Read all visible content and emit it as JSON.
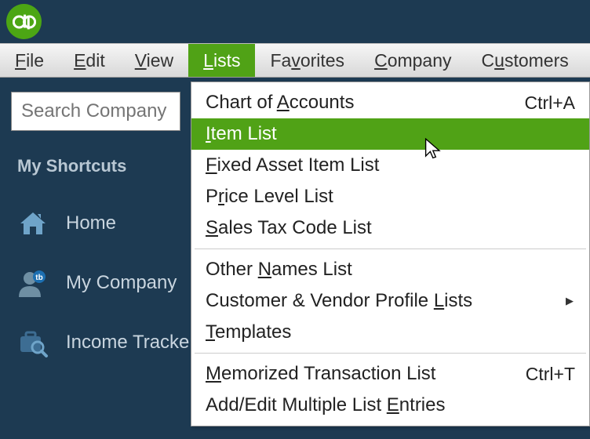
{
  "app": {
    "logo_letters": "qb"
  },
  "menubar": {
    "file": "File",
    "file_u": "F",
    "edit": "Edit",
    "edit_u": "E",
    "view": "View",
    "view_u": "V",
    "lists": "Lists",
    "lists_u": "L",
    "favorites": "Favorites",
    "favorites_u": "v",
    "company": "Company",
    "company_u": "C",
    "customers": "Customers",
    "customers_u": "u"
  },
  "search": {
    "placeholder": "Search Company"
  },
  "sidebar": {
    "title": "My Shortcuts",
    "items": [
      {
        "label": "Home"
      },
      {
        "label": "My Company"
      },
      {
        "label": "Income Tracker"
      }
    ]
  },
  "dropdown": {
    "chart_of_accounts": {
      "pre": "Chart of ",
      "u": "A",
      "post": "ccounts",
      "shortcut": "Ctrl+A"
    },
    "item_list": {
      "pre": "",
      "u": "I",
      "post": "tem List"
    },
    "fixed_asset": {
      "pre": "",
      "u": "F",
      "post": "ixed Asset Item List"
    },
    "price_level": {
      "pre": "P",
      "u": "r",
      "post": "ice Level List"
    },
    "sales_tax": {
      "pre": "",
      "u": "S",
      "post": "ales Tax Code List"
    },
    "other_names": {
      "pre": "Other ",
      "u": "N",
      "post": "ames List"
    },
    "cust_vendor": {
      "pre": "Customer & Vendor Profile ",
      "u": "L",
      "post": "ists"
    },
    "templates": {
      "pre": "",
      "u": "T",
      "post": "emplates"
    },
    "memorized": {
      "pre": "",
      "u": "M",
      "post": "emorized Transaction List",
      "shortcut": "Ctrl+T"
    },
    "add_edit": {
      "pre": "Add/Edit Multiple List ",
      "u": "E",
      "post": "ntries"
    }
  }
}
